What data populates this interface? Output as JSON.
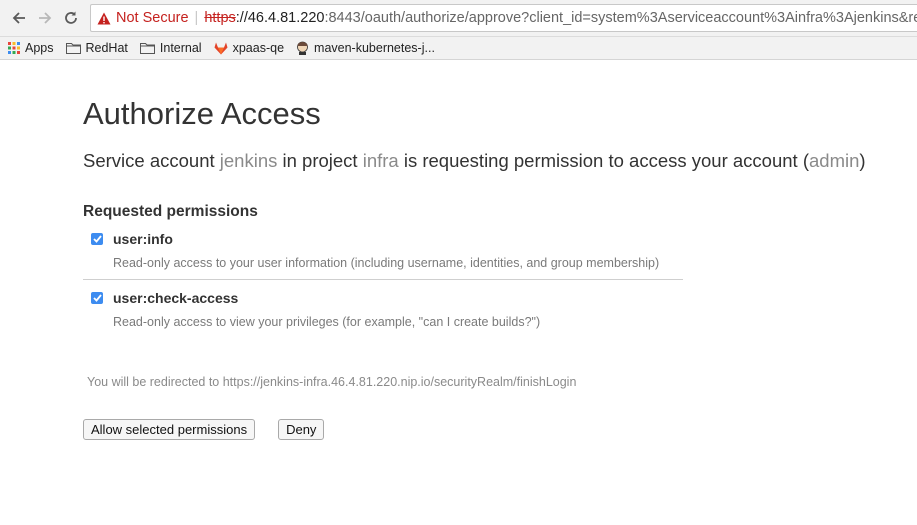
{
  "browser": {
    "security_label": "Not Secure",
    "url_scheme": "https",
    "url_host": "://46.4.81.220",
    "url_rest": ":8443/oauth/authorize/approve?client_id=system%3Aserviceaccount%3Ainfra%3Ajenkins&re"
  },
  "bookmarks": [
    {
      "label": "Apps",
      "icon": "apps-grid-icon"
    },
    {
      "label": "RedHat",
      "icon": "folder-icon"
    },
    {
      "label": "Internal",
      "icon": "folder-icon"
    },
    {
      "label": "xpaas-qe",
      "icon": "gitlab-icon"
    },
    {
      "label": "maven-kubernetes-j...",
      "icon": "jenkins-icon"
    }
  ],
  "page": {
    "title": "Authorize Access",
    "subtitle_parts": {
      "p1": "Service account ",
      "account": "jenkins",
      "p2": " in project ",
      "project": "infra",
      "p3": " is requesting permission to access your account (",
      "user": "admin",
      "p4": ")"
    },
    "permissions_heading": "Requested permissions",
    "permissions": [
      {
        "name": "user:info",
        "description": "Read-only access to your user information (including username, identities, and group membership)",
        "checked": true
      },
      {
        "name": "user:check-access",
        "description": "Read-only access to view your privileges (for example, \"can I create builds?\")",
        "checked": true
      }
    ],
    "redirect_text": "You will be redirected to https://jenkins-infra.46.4.81.220.nip.io/securityRealm/finishLogin",
    "allow_label": "Allow selected permissions",
    "deny_label": "Deny"
  },
  "colors": {
    "accent_checkbox": "#3d8cf0",
    "not_secure": "#c5221f",
    "highlight_text": "#8a8a8a"
  }
}
